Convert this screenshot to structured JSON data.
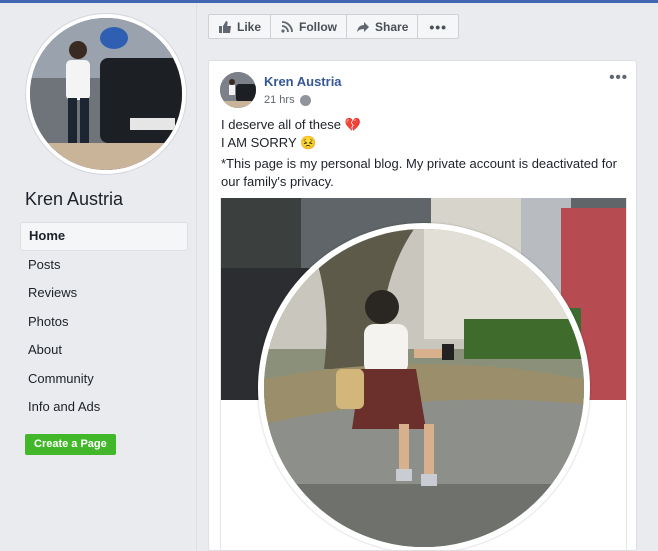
{
  "page": {
    "name": "Kren Austria"
  },
  "sidebar": {
    "items": [
      {
        "label": "Home",
        "active": true
      },
      {
        "label": "Posts"
      },
      {
        "label": "Reviews"
      },
      {
        "label": "Photos"
      },
      {
        "label": "About"
      },
      {
        "label": "Community"
      },
      {
        "label": "Info and Ads"
      }
    ],
    "create_page_label": "Create a Page"
  },
  "actions": {
    "like": "Like",
    "follow": "Follow",
    "share": "Share",
    "more": "•••"
  },
  "post": {
    "author": "Kren Austria",
    "time": "21 hrs",
    "privacy_icon": "globe-icon",
    "menu": "•••",
    "line1": "I deserve all of these 💔",
    "line2": "I AM SORRY 😣",
    "line3": "*This page is my personal blog. My private account is deactivated for our family's privacy."
  },
  "colors": {
    "brand": "#4267b2",
    "link": "#365899",
    "create_button": "#42b72a"
  }
}
